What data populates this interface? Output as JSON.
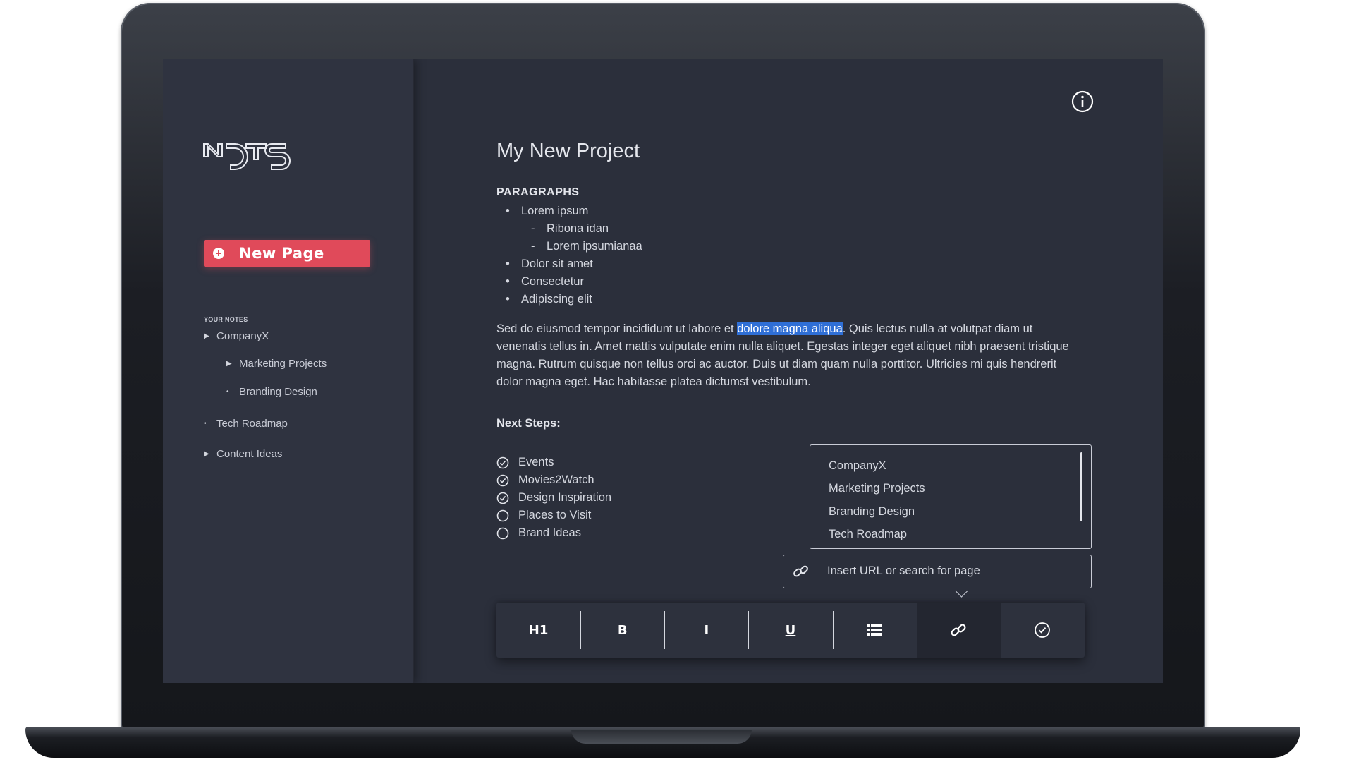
{
  "sidebar": {
    "logo_text": "NDTS",
    "new_page_label": "New Page",
    "notes_heading": "YOUR NOTES",
    "tree": [
      {
        "label": "CompanyX",
        "marker": "▶"
      },
      {
        "label": "Marketing Projects",
        "marker": "▶"
      },
      {
        "label": "Branding Design",
        "marker": "•"
      },
      {
        "label": "Tech Roadmap",
        "marker": "•"
      },
      {
        "label": "Content Ideas",
        "marker": "▶"
      }
    ]
  },
  "main": {
    "title": "My New Project",
    "section_heading": "PARAGRAPHS",
    "list": [
      {
        "text": "Lorem ipsum",
        "marker": "•"
      },
      {
        "text": "Ribona idan",
        "marker": "-"
      },
      {
        "text": "Lorem ipsumianaa",
        "marker": "-"
      },
      {
        "text": "Dolor sit amet",
        "marker": "•"
      },
      {
        "text": "Consectetur",
        "marker": "•"
      },
      {
        "text": "Adipiscing elit",
        "marker": "•"
      }
    ],
    "paragraph": {
      "before": "Sed do eiusmod tempor incididunt ut labore et ",
      "highlight": "dolore magna aliqua",
      "after": ". Quis lectus nulla at volutpat diam ut venenatis tellus in. Amet mattis vulputate enim nulla aliquet. Egestas integer eget aliquet nibh praesent tristique magna. Rutrum quisque non tellus orci ac auctor. Duis ut diam quam nulla porttitor. Ultricies mi quis hendrerit dolor magna eget. Hac habitasse platea dictumst vestibulum."
    },
    "next_steps_heading": "Next Steps:",
    "checklist": [
      {
        "label": "Events",
        "checked": true
      },
      {
        "label": "Movies2Watch",
        "checked": true
      },
      {
        "label": "Design Inspiration",
        "checked": true
      },
      {
        "label": "Places to Visit",
        "checked": false
      },
      {
        "label": "Brand Ideas",
        "checked": false
      }
    ]
  },
  "link_popup": {
    "suggestions": [
      "CompanyX",
      "Marketing Projects",
      "Branding Design",
      "Tech Roadmap"
    ],
    "placeholder": "Insert URL or search for page"
  },
  "toolbar": {
    "h1_label": "H1",
    "bold_label": "B",
    "italic_label": "I",
    "underline_label": "U",
    "list_icon": "list-icon",
    "link_icon": "link-icon",
    "check_icon": "check-circle-icon"
  },
  "colors": {
    "accent": "#e04a5a",
    "highlight": "#2f6fd6",
    "background": "#2b2f3b",
    "sidebar": "#2f3340"
  }
}
